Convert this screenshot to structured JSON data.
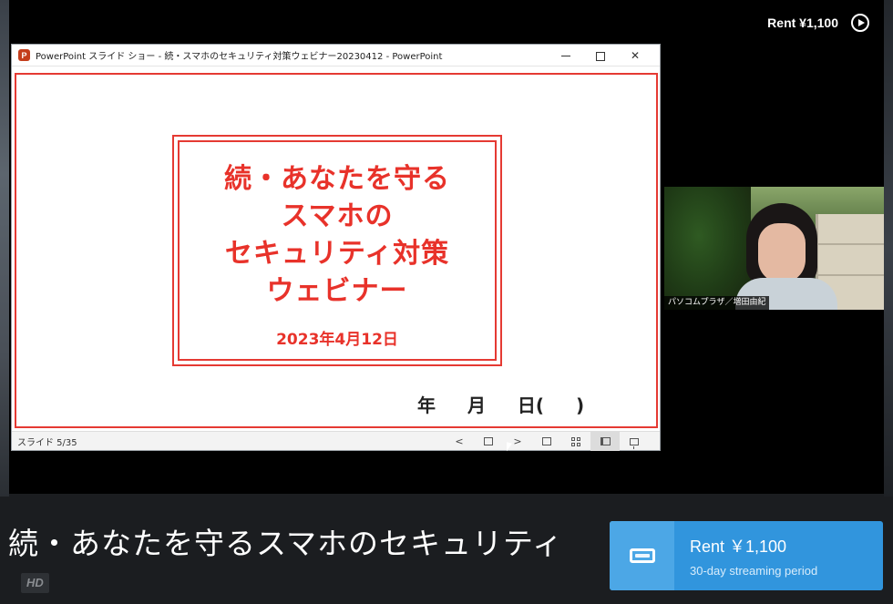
{
  "topbar": {
    "rent_label": "Rent ¥1,100",
    "play_icon": "play-circle-icon"
  },
  "powerpoint": {
    "window_title": "PowerPoint スライド ショー  -  続・スマホのセキュリティ対策ウェビナー20230412 - PowerPoint",
    "logo_letter": "P",
    "window_controls": [
      "minimize",
      "maximize",
      "close"
    ],
    "close_glyph": "✕",
    "slide": {
      "title_lines": [
        "続・あなたを守る",
        "スマホの",
        "セキュリティ対策",
        "ウェビナー"
      ],
      "date": "2023年4月12日",
      "date_blank": "年　 月　 日(　 )"
    },
    "statusbar": {
      "slide_counter": "スライド 5/35",
      "prev_glyph": "<",
      "next_glyph": ">"
    }
  },
  "webcam": {
    "name_label": "パソコムプラザ／増田由紀"
  },
  "video": {
    "title": "続・あなたを守るスマホのセキュリティ",
    "quality_badge": "HD"
  },
  "rent_button": {
    "label": "Rent ￥1,100",
    "sublabel": "30-day streaming period",
    "icon": "ticket-icon"
  },
  "colors": {
    "slide_red": "#e8322a",
    "rent_blue": "#3195dd",
    "rent_icon_blue": "#4ca7e6",
    "page_bg": "#1b1d20"
  }
}
